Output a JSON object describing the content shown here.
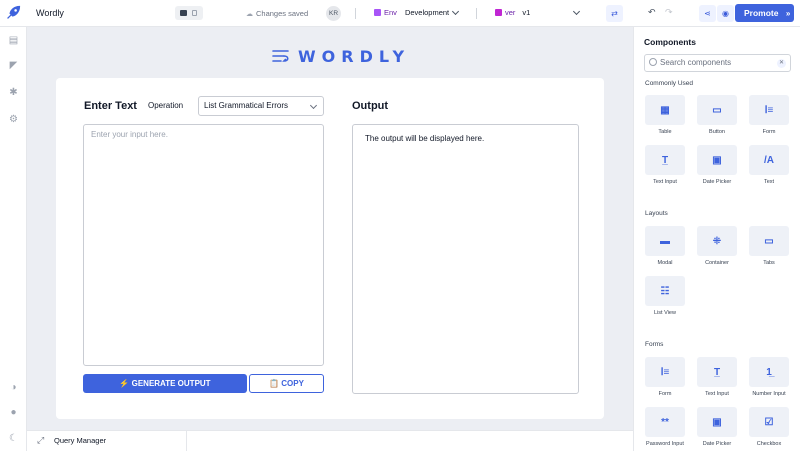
{
  "app": {
    "name": "Wordly"
  },
  "topbar": {
    "status": "Changes saved",
    "avatar_initials": "KR",
    "env_label": "Env",
    "env_value": "Development",
    "ver_label": "ver",
    "ver_value": "v1",
    "promote_label": "Promote"
  },
  "canvas": {
    "brand": "WORDLY",
    "enter_heading": "Enter Text",
    "operation_label": "Operation",
    "operation_value": "List Grammatical Errors",
    "output_heading": "Output",
    "input_placeholder": "Enter your input here.",
    "output_text": "The output will be displayed here.",
    "generate_label": "⚡ GENERATE OUTPUT",
    "copy_label": "📋 COPY"
  },
  "bottombar": {
    "query_manager": "Query Manager"
  },
  "components_panel": {
    "title": "Components",
    "search_placeholder": "Search components",
    "sections": [
      {
        "label": "Commonly Used",
        "items": [
          "Table",
          "Button",
          "Form",
          "Text Input",
          "Date Picker",
          "Text"
        ]
      },
      {
        "label": "Layouts",
        "items": [
          "Modal",
          "Container",
          "Tabs",
          "List View"
        ]
      },
      {
        "label": "Forms",
        "items": [
          "Form",
          "Text Input",
          "Number Input",
          "Password Input",
          "Date Picker",
          "Checkbox"
        ]
      }
    ]
  },
  "colors": {
    "accent": "#3e63dd",
    "canvas_bg": "#eceef3",
    "env_purple": "#6b21a8"
  }
}
